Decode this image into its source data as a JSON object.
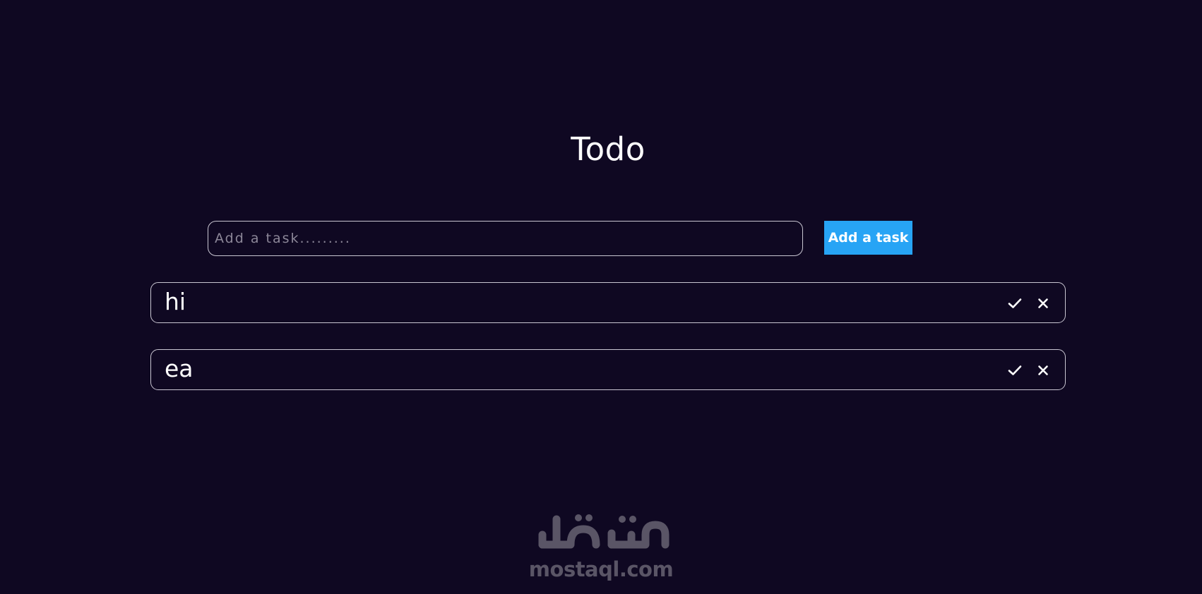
{
  "app": {
    "title": "Todo"
  },
  "add_form": {
    "placeholder": "Add a task.........",
    "value": "",
    "button_label": "Add a task"
  },
  "tasks": [
    {
      "text": "hi"
    },
    {
      "text": "ea"
    }
  ],
  "icons": {
    "complete": "check-icon",
    "delete": "close-icon"
  },
  "footer_logo": {
    "arabic_text": "مستقل",
    "domain": "mostaql.com"
  },
  "colors": {
    "background": "#0f0822",
    "accent": "#27a4f5",
    "border": "#c9c6d2",
    "text": "#ffffff",
    "placeholder": "#8c8798",
    "logo": "#5a5566"
  }
}
